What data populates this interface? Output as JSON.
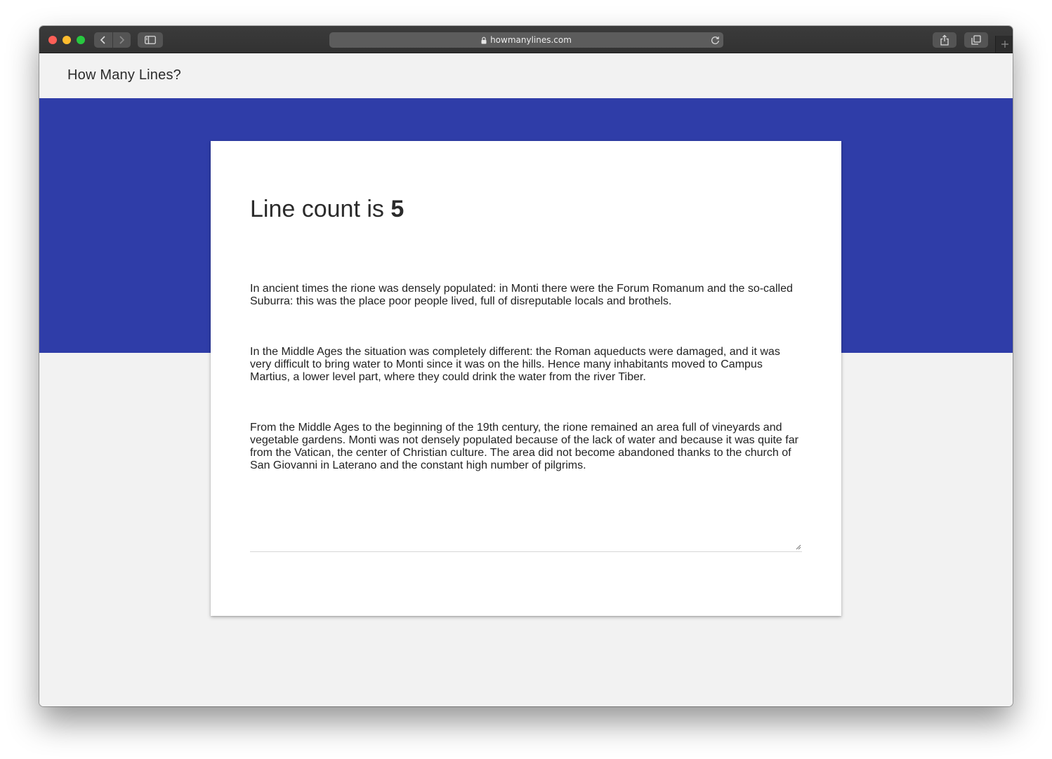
{
  "browser": {
    "url": "howmanylines.com",
    "icons": {
      "back": "chevron-left-icon",
      "forward": "chevron-right-icon",
      "sidebar": "sidebar-icon",
      "lock": "lock-icon",
      "reload": "reload-icon",
      "share": "share-icon",
      "tabs": "tabs-icon",
      "new_tab": "plus-icon"
    }
  },
  "site": {
    "title": "How Many Lines?"
  },
  "result": {
    "prefix": "Line count is ",
    "count": "5"
  },
  "textarea": {
    "paragraphs": [
      "In ancient times the rione was densely populated: in Monti there were the Forum Romanum and the so-called Suburra: this was the place poor people lived, full of disreputable locals and brothels.",
      "In the Middle Ages the situation was completely different: the Roman aqueducts were damaged, and it was very difficult to bring water to Monti since it was on the hills. Hence many inhabitants moved to Campus Martius, a lower level part, where they could drink the water from the river Tiber.",
      "From the Middle Ages to the beginning of the 19th century, the rione remained an area full of vineyards and vegetable gardens. Monti was not densely populated because of the lack of water and because it was quite far from the Vatican, the center of Christian culture. The area did not become abandoned thanks to the church of San Giovanni in Laterano and the constant high number of pilgrims."
    ]
  },
  "colors": {
    "hero": "#2f3da8",
    "page_bg": "#f2f2f2",
    "card_bg": "#ffffff",
    "text": "#2b2b2b"
  }
}
